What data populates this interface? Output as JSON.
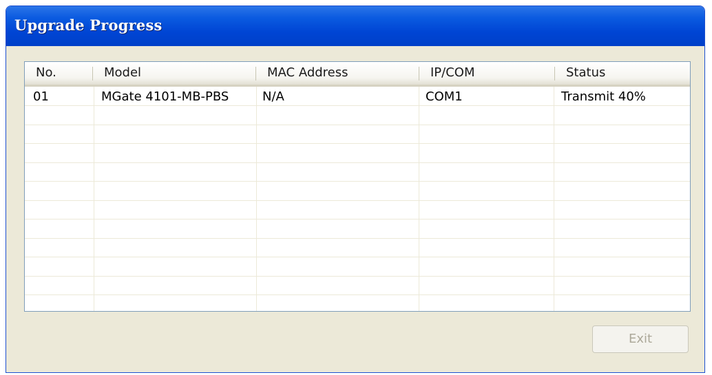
{
  "window": {
    "title": "Upgrade Progress"
  },
  "table": {
    "columns": [
      "No.",
      "Model",
      "MAC Address",
      "IP/COM",
      "Status"
    ],
    "rows": [
      {
        "no": "01",
        "model": "MGate 4101-MB-PBS",
        "mac": "N/A",
        "ipcom": "COM1",
        "status": "Transmit 40%"
      }
    ],
    "progress_percent": 40
  },
  "buttons": {
    "exit_label": "Exit",
    "exit_enabled": false
  },
  "colors": {
    "title_bar": "#0a5ae0",
    "window_face": "#ece9d8",
    "list_border": "#7f9db9",
    "disabled_text": "#aca899"
  }
}
